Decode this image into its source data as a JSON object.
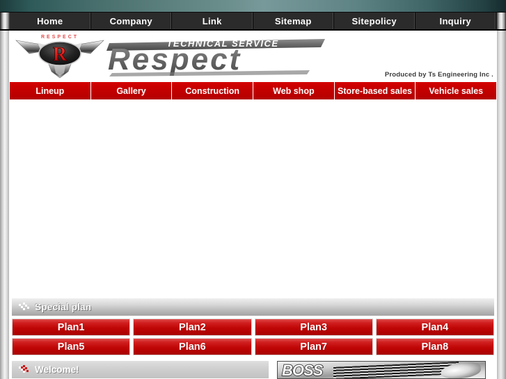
{
  "top_nav": {
    "items": [
      {
        "label": "Home",
        "icon": "home-icon"
      },
      {
        "label": "Company",
        "icon": "company-icon"
      },
      {
        "label": "Link",
        "icon": "link-icon"
      },
      {
        "label": "Sitemap",
        "icon": "sitemap-icon"
      },
      {
        "label": "Sitepolicy",
        "icon": "sitepolicy-icon"
      },
      {
        "label": "Inquiry",
        "icon": "inquiry-icon"
      }
    ]
  },
  "branding": {
    "emblem_letter": "R",
    "emblem_text": "RESPECT",
    "tagline": "TECHNICAL SERVICE",
    "wordmark": "Respect",
    "produced_by": "Produced by Ts Engineering Inc ."
  },
  "red_nav": {
    "items": [
      {
        "label": "Lineup"
      },
      {
        "label": "Gallery"
      },
      {
        "label": "Construction"
      },
      {
        "label": "Web shop"
      },
      {
        "label": "Store-based sales"
      },
      {
        "label": "Vehicle sales"
      }
    ]
  },
  "special_plan": {
    "header": "Special plan",
    "header_icon": "checkered-flag-icon",
    "plans": [
      {
        "label": "Plan1"
      },
      {
        "label": "Plan2"
      },
      {
        "label": "Plan3"
      },
      {
        "label": "Plan4"
      },
      {
        "label": "Plan5"
      },
      {
        "label": "Plan6"
      },
      {
        "label": "Plan7"
      },
      {
        "label": "Plan8"
      }
    ]
  },
  "welcome": {
    "header": "Welcome!",
    "header_icon": "checkered-flag-icon-red"
  },
  "promo": {
    "banner_text": "BOSS",
    "image_alt": "car-front-photo"
  },
  "colors": {
    "top_strip_teal": "#5a8080",
    "top_nav_dark": "#2b2b2b",
    "brand_red": "#c80000",
    "plan_red": "#c00606",
    "section_gray": "#c2c2c2",
    "emblem_red": "#e01b1b"
  }
}
